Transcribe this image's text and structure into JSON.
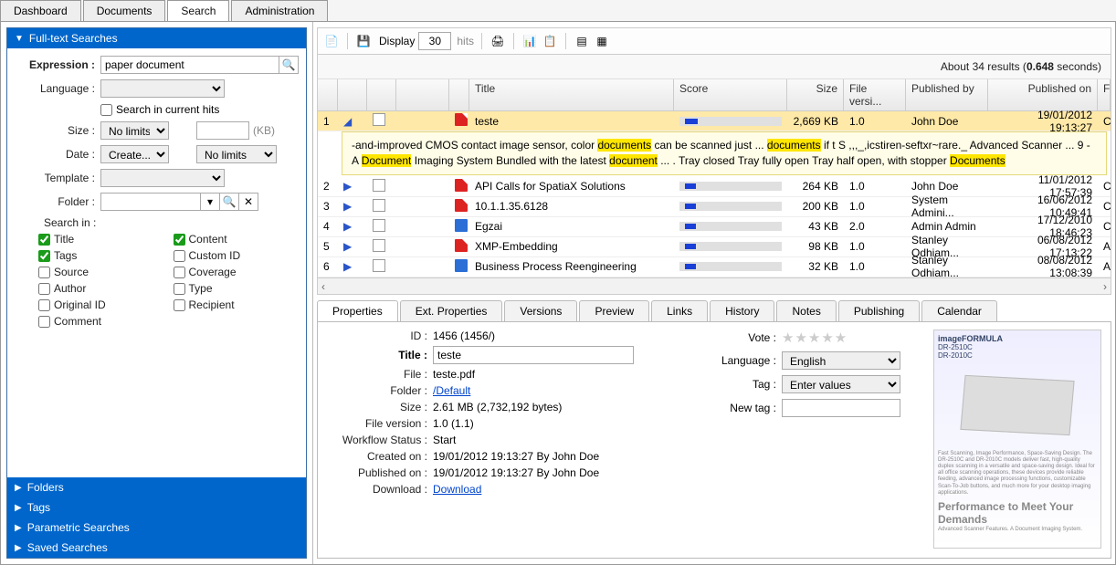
{
  "top_tabs": [
    "Dashboard",
    "Documents",
    "Search",
    "Administration"
  ],
  "top_active": 2,
  "sidebar": {
    "sections": [
      "Full-text Searches",
      "Folders",
      "Tags",
      "Parametric Searches",
      "Saved Searches"
    ]
  },
  "form": {
    "expression_label": "Expression :",
    "expression_value": "paper document",
    "language_label": "Language :",
    "search_current": "Search in current hits",
    "size_label": "Size :",
    "size_value": "No limits",
    "kb": "(KB)",
    "date_label": "Date :",
    "date_create": "Create...",
    "date_limit": "No limits",
    "template_label": "Template :",
    "folder_label": "Folder :",
    "search_in": "Search in :",
    "checks": [
      "Title",
      "Content",
      "Tags",
      "Custom ID",
      "Source",
      "Coverage",
      "Author",
      "Type",
      "Original ID",
      "Recipient",
      "Comment"
    ]
  },
  "toolbar": {
    "display": "Display",
    "display_val": "30",
    "hits": "hits"
  },
  "results": {
    "info_prefix": "About 34 results (",
    "info_seconds": "0.648",
    "info_suffix": " seconds)",
    "columns": [
      "",
      "",
      "",
      "",
      "",
      "Title",
      "Score",
      "Size",
      "File versi...",
      "Published by",
      "Published on",
      "F"
    ],
    "rows": [
      {
        "n": "1",
        "icon": "pdf",
        "title": "teste",
        "score": 14,
        "size": "2,669 KB",
        "ver": "1.0",
        "by": "John Doe",
        "on": "19/01/2012 19:13:27",
        "f": "C"
      },
      {
        "n": "2",
        "icon": "pdf",
        "title": "API Calls for SpatiaX Solutions",
        "score": 12,
        "size": "264 KB",
        "ver": "1.0",
        "by": "John Doe",
        "on": "11/01/2012 17:57:39",
        "f": "C"
      },
      {
        "n": "3",
        "icon": "pdf",
        "title": "10.1.1.35.6128",
        "score": 10,
        "size": "200 KB",
        "ver": "1.0",
        "by": "System Admini...",
        "on": "16/06/2012 10:49:41",
        "f": "C"
      },
      {
        "n": "4",
        "icon": "doc",
        "title": "Egzai",
        "score": 8,
        "size": "43 KB",
        "ver": "2.0",
        "by": "Admin Admin",
        "on": "17/12/2010 18:46:23",
        "f": "C"
      },
      {
        "n": "5",
        "icon": "pdf",
        "title": "XMP-Embedding",
        "score": 7,
        "size": "98 KB",
        "ver": "1.0",
        "by": "Stanley Odhiam...",
        "on": "06/08/2012 17:13:22",
        "f": "A"
      },
      {
        "n": "6",
        "icon": "doc",
        "title": "Business Process Reengineering",
        "score": 6,
        "size": "32 KB",
        "ver": "1.0",
        "by": "Stanley Odhiam...",
        "on": "08/08/2012 13:08:39",
        "f": "A"
      }
    ],
    "snippet_pre": "-and-improved CMOS contact image sensor, color ",
    "hl1": "documents",
    "snippet_mid1": " can be scanned just ... ",
    "hl2": "documents",
    "snippet_mid2": " if t S ,,,_,icstiren-seftxr~rare._ Advanced Scanner ... 9 - A ",
    "hl3": "Document",
    "snippet_mid3": " Imaging System Bundled with the latest ",
    "hl4": "document",
    "snippet_mid4": " ... . Tray closed Tray fully open Tray half open, with stopper ",
    "hl5": "Documents"
  },
  "detail_tabs": [
    "Properties",
    "Ext. Properties",
    "Versions",
    "Preview",
    "Links",
    "History",
    "Notes",
    "Publishing",
    "Calendar"
  ],
  "detail_active": 0,
  "props": {
    "id_label": "ID :",
    "id": "1456 (1456/)",
    "title_label": "Title :",
    "title": "teste",
    "file_label": "File :",
    "file": "teste.pdf",
    "folder_label": "Folder :",
    "folder": "/Default",
    "size_label": "Size :",
    "size": "2.61 MB (2,732,192 bytes)",
    "filever_label": "File version :",
    "filever": "1.0 (1.1)",
    "workflow_label": "Workflow Status :",
    "workflow": "Start",
    "created_label": "Created on :",
    "created": "19/01/2012 19:13:27 By John Doe",
    "published_label": "Published on :",
    "published": "19/01/2012 19:13:27 By John Doe",
    "download_label": "Download :",
    "download": "Download"
  },
  "side": {
    "vote": "Vote :",
    "language": "Language :",
    "lang_val": "English",
    "tag": "Tag :",
    "tag_val": "Enter values",
    "newtag": "New tag :"
  },
  "preview_text": {
    "t1": "imageFORMULA",
    "t2": "DR-2510C",
    "t3": "DR-2010C"
  }
}
